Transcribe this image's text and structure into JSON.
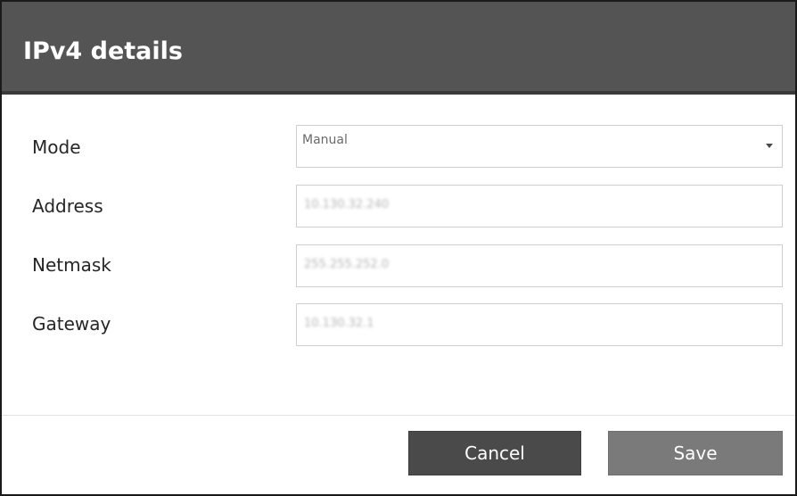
{
  "dialog": {
    "title": "IPv4 details"
  },
  "form": {
    "mode": {
      "label": "Mode",
      "selected": "Manual"
    },
    "address": {
      "label": "Address",
      "value": "10.130.32.240"
    },
    "netmask": {
      "label": "Netmask",
      "value": "255.255.252.0"
    },
    "gateway": {
      "label": "Gateway",
      "value": "10.130.32.1"
    }
  },
  "buttons": {
    "cancel": "Cancel",
    "save": "Save"
  },
  "icons": {
    "dropdown": "chevron-down-icon"
  },
  "colors": {
    "header": "#545454",
    "cancel_button": "#4a4a4a",
    "save_button": "#7a7a7a"
  }
}
